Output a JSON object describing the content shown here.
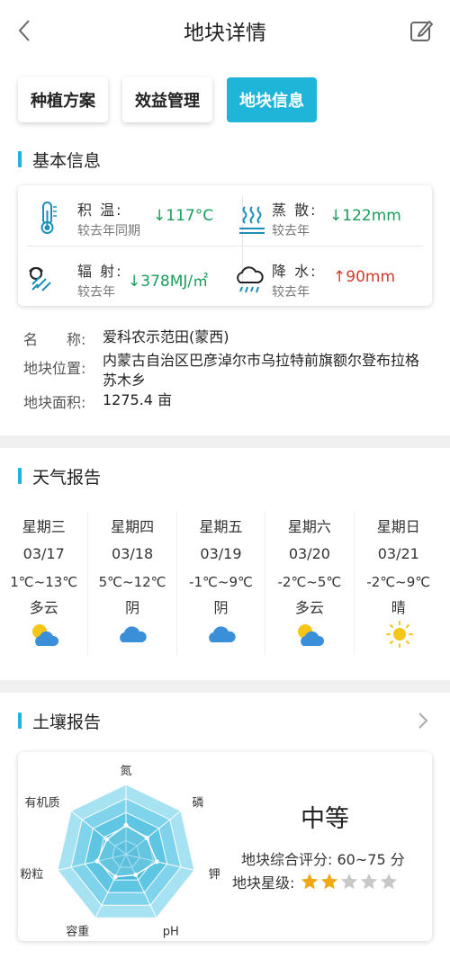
{
  "header": {
    "title": "地块详情"
  },
  "tabs": [
    {
      "label": "种植方案",
      "active": false
    },
    {
      "label": "效益管理",
      "active": false
    },
    {
      "label": "地块信息",
      "active": true
    }
  ],
  "basic_info": {
    "title": "基本信息",
    "metrics": [
      {
        "label": "积 温:",
        "sub": "较去年同期",
        "arrow": "↓",
        "value": "117°C",
        "trend": "down",
        "icon": "thermometer-icon"
      },
      {
        "label": "蒸 散:",
        "sub": "较去年",
        "arrow": "↓",
        "value": "122mm",
        "trend": "down",
        "icon": "evaporation-icon"
      },
      {
        "label": "辐 射:",
        "sub": "较去年",
        "arrow": "↓",
        "value": "378MJ/㎡",
        "trend": "down",
        "icon": "radiation-icon"
      },
      {
        "label": "降 水:",
        "sub": "较去年",
        "arrow": "↑",
        "value": "90mm",
        "trend": "up",
        "icon": "rain-cloud-icon"
      }
    ],
    "fields": [
      {
        "label": "名　　称:",
        "value": "爱科农示范田(蒙西)"
      },
      {
        "label": "地块位置:",
        "value": "内蒙古自治区巴彦淖尔市乌拉特前旗额尔登布拉格苏木乡"
      },
      {
        "label": "地块面积:",
        "value": "1275.4 亩"
      }
    ]
  },
  "weather": {
    "title": "天气报告",
    "days": [
      {
        "weekday": "星期三",
        "date": "03/17",
        "temp": "1℃~13℃",
        "condition": "多云",
        "icon": "partly-cloudy-icon"
      },
      {
        "weekday": "星期四",
        "date": "03/18",
        "temp": "5℃~12℃",
        "condition": "阴",
        "icon": "cloudy-icon"
      },
      {
        "weekday": "星期五",
        "date": "03/19",
        "temp": "-1℃~9℃",
        "condition": "阴",
        "icon": "cloudy-icon"
      },
      {
        "weekday": "星期六",
        "date": "03/20",
        "temp": "-2℃~5℃",
        "condition": "多云",
        "icon": "partly-cloudy-icon"
      },
      {
        "weekday": "星期日",
        "date": "03/21",
        "temp": "-2℃~9℃",
        "condition": "晴",
        "icon": "sunny-icon"
      }
    ]
  },
  "soil": {
    "title": "土壤报告",
    "radar_labels": [
      "氮",
      "磷",
      "钾",
      "pH",
      "容重",
      "粉粒",
      "有机质"
    ],
    "radar_values": [
      0.42,
      0.38,
      0.45,
      0.32,
      0.35,
      0.42,
      0.35
    ],
    "grade": "中等",
    "score_label": "地块综合评分:",
    "score_value": "60~75 分",
    "stars_label": "地块星级:",
    "stars_filled": 2,
    "stars_total": 5
  },
  "colors": {
    "accent": "#1fb5d8",
    "down": "#1a9c5a",
    "up": "#d23a2b",
    "star_on": "#f0a814",
    "star_off": "#c8c8c8"
  }
}
